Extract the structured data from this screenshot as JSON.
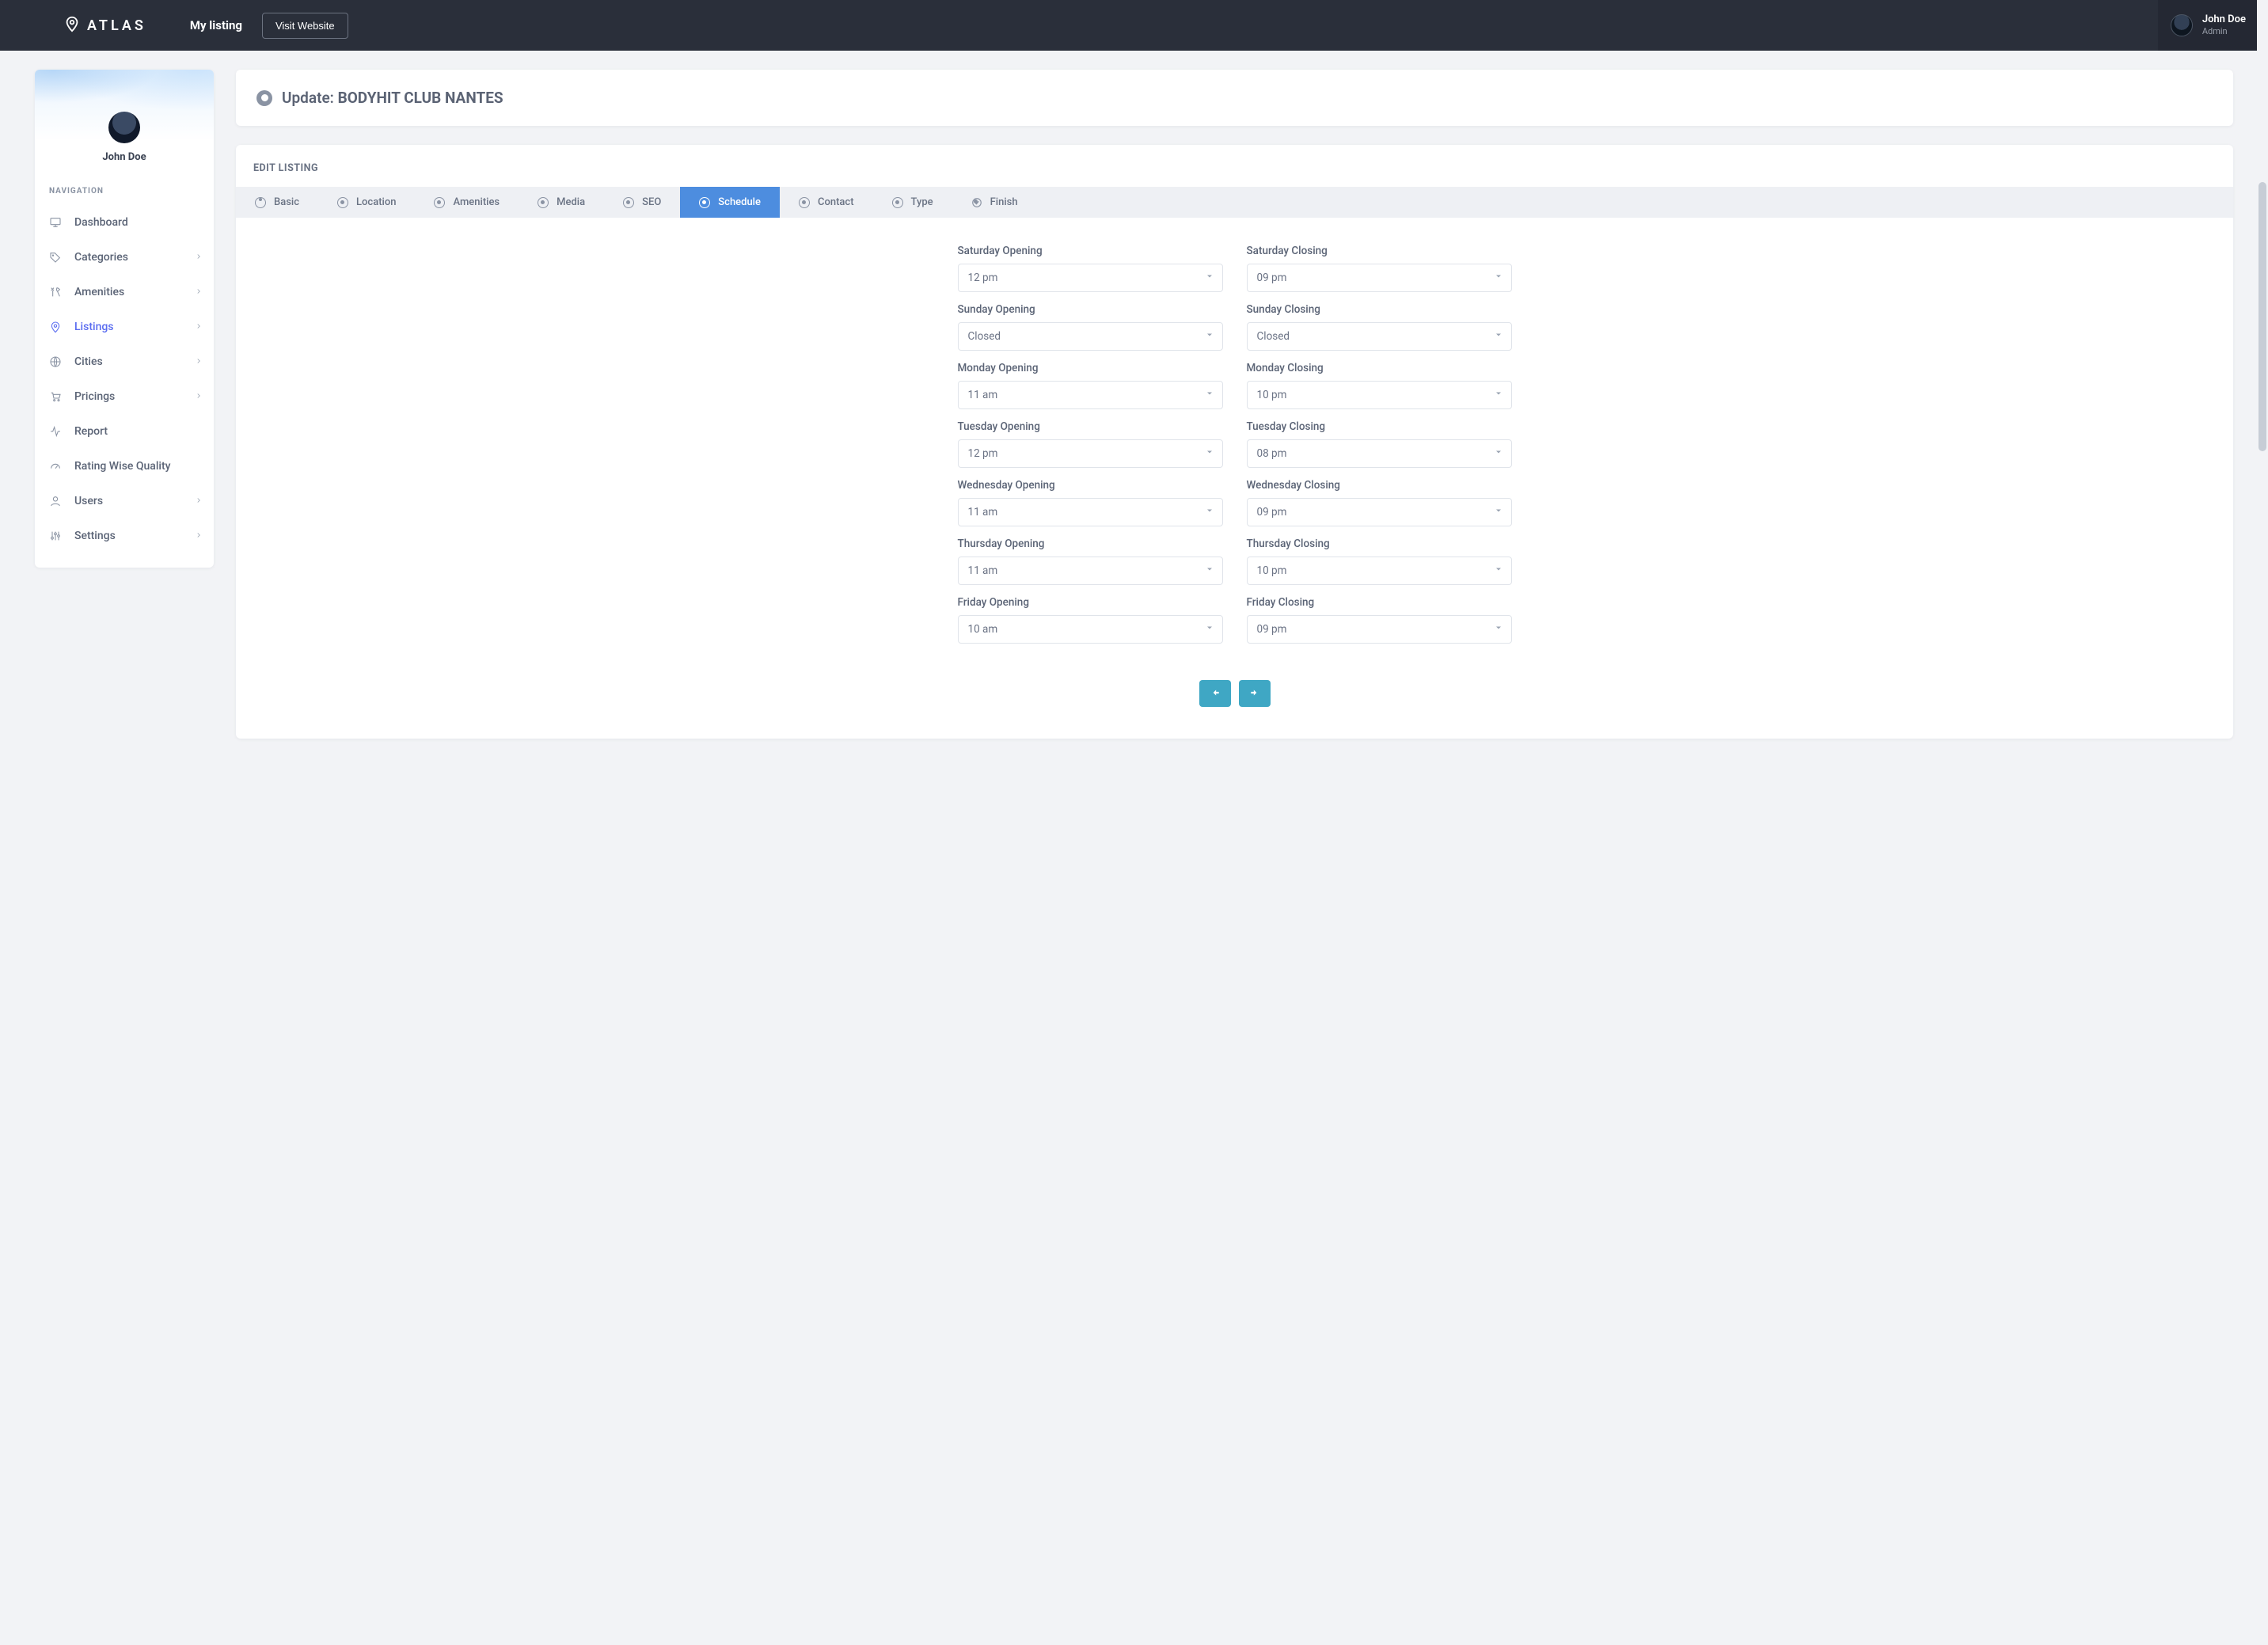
{
  "brand": "ATLAS",
  "topbar": {
    "my_listing": "My listing",
    "visit_label": "Visit Website"
  },
  "user": {
    "name": "John Doe",
    "role": "Admin"
  },
  "sidebar": {
    "user_name": "John Doe",
    "nav_title": "NAVIGATION",
    "items": [
      {
        "key": "dashboard",
        "label": "Dashboard",
        "icon": "monitor",
        "expandable": false
      },
      {
        "key": "categories",
        "label": "Categories",
        "icon": "tag",
        "expandable": true
      },
      {
        "key": "amenities",
        "label": "Amenities",
        "icon": "utensils",
        "expandable": true
      },
      {
        "key": "listings",
        "label": "Listings",
        "icon": "pin",
        "expandable": true,
        "active": true
      },
      {
        "key": "cities",
        "label": "Cities",
        "icon": "globe",
        "expandable": true
      },
      {
        "key": "pricings",
        "label": "Pricings",
        "icon": "cart",
        "expandable": true
      },
      {
        "key": "report",
        "label": "Report",
        "icon": "activity",
        "expandable": false
      },
      {
        "key": "rating",
        "label": "Rating Wise Quality",
        "icon": "gauge",
        "expandable": false
      },
      {
        "key": "users",
        "label": "Users",
        "icon": "user",
        "expandable": true
      },
      {
        "key": "settings",
        "label": "Settings",
        "icon": "sliders",
        "expandable": true
      }
    ]
  },
  "page": {
    "heading_prefix": "Update: ",
    "heading_value": "BODYHIT CLUB NANTES",
    "panel_title": "EDIT LISTING"
  },
  "tabs": [
    {
      "key": "basic",
      "label": "Basic"
    },
    {
      "key": "location",
      "label": "Location"
    },
    {
      "key": "amenities",
      "label": "Amenities"
    },
    {
      "key": "media",
      "label": "Media"
    },
    {
      "key": "seo",
      "label": "SEO"
    },
    {
      "key": "schedule",
      "label": "Schedule",
      "active": true
    },
    {
      "key": "contact",
      "label": "Contact"
    },
    {
      "key": "type",
      "label": "Type"
    },
    {
      "key": "finish",
      "label": "Finish"
    }
  ],
  "schedule": {
    "rows": [
      {
        "day": "Saturday",
        "open": "12 pm",
        "close": "09 pm"
      },
      {
        "day": "Sunday",
        "open": "Closed",
        "close": "Closed"
      },
      {
        "day": "Monday",
        "open": "11 am",
        "close": "10 pm"
      },
      {
        "day": "Tuesday",
        "open": "12 pm",
        "close": "08 pm"
      },
      {
        "day": "Wednesday",
        "open": "11 am",
        "close": "09 pm"
      },
      {
        "day": "Thursday",
        "open": "11 am",
        "close": "10 pm"
      },
      {
        "day": "Friday",
        "open": "10 am",
        "close": "09 pm"
      }
    ],
    "label_open_suffix": " Opening",
    "label_close_suffix": " Closing"
  },
  "colors": {
    "topbar": "#2a2f3a",
    "accent": "#5a6cf0",
    "tab_active": "#4d8ddf",
    "button_teal": "#3fa7c4"
  }
}
